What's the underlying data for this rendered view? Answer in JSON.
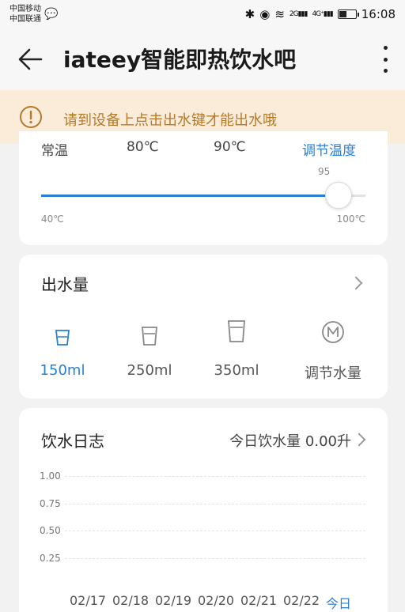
{
  "status": {
    "carrier1": "中国移动",
    "carrier2": "中国联通",
    "net1": "2G",
    "net2": "4G⁺",
    "time": "16:08"
  },
  "header": {
    "title": "iateey智能即热饮水吧"
  },
  "notice": {
    "text": "请到设备上点击出水键才能出水哦"
  },
  "temperature": {
    "presets": [
      "常温",
      "80℃",
      "90℃"
    ],
    "adjust_label": "调节温度",
    "current_value": "95",
    "min_label": "40℃",
    "max_label": "100℃",
    "min": 40,
    "max": 100,
    "value": 95
  },
  "water_amount": {
    "title": "出水量",
    "options": [
      {
        "label": "150ml",
        "icon": "small-cup-icon",
        "selected": true
      },
      {
        "label": "250ml",
        "icon": "medium-cup-icon",
        "selected": false
      },
      {
        "label": "350ml",
        "icon": "large-cup-icon",
        "selected": false
      },
      {
        "label": "调节水量",
        "icon": "m-circle-icon",
        "selected": false
      }
    ]
  },
  "log": {
    "title": "饮水日志",
    "summary": "今日饮水量 0.00升"
  },
  "chart_data": {
    "type": "bar",
    "categories": [
      "02/17",
      "02/18",
      "02/19",
      "02/20",
      "02/21",
      "02/22",
      "今日"
    ],
    "values": [
      0,
      0,
      0,
      0,
      0,
      0,
      0
    ],
    "yticks": [
      "1.00",
      "0.75",
      "0.50",
      "0.25"
    ],
    "ylim": [
      0,
      1
    ],
    "grid": true
  },
  "colors": {
    "accent": "#2b7fd1",
    "notice_bg": "#fbecd9",
    "notice_text": "#b47a2a"
  }
}
